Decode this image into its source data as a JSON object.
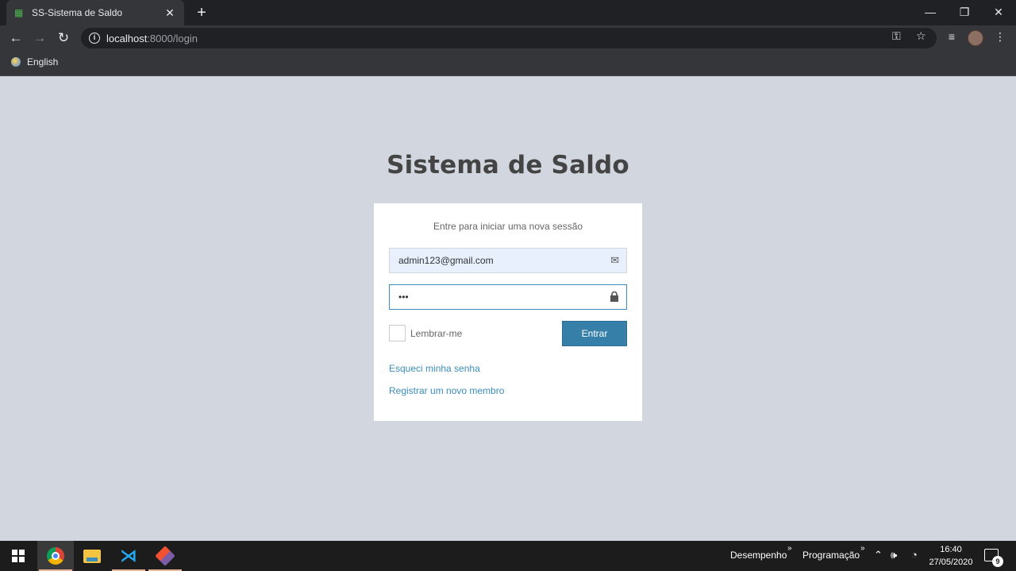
{
  "browser": {
    "tab_title": "SS-Sistema de Saldo",
    "tab_close": "✕",
    "new_tab": "+",
    "window_controls": {
      "minimize": "—",
      "restore": "❐",
      "close": "✕"
    },
    "nav": {
      "back": "←",
      "forward": "→",
      "reload": "↻"
    },
    "url_host": "localhost",
    "url_path": ":8000/login",
    "bookmark_label": "English"
  },
  "page": {
    "logo": "Sistema de Saldo",
    "box_message": "Entre para iniciar uma nova sessão",
    "email_value": "admin123@gmail.com",
    "password_value": "•••",
    "remember_label": "Lembrar-me",
    "submit_label": "Entrar",
    "forgot_link": "Esqueci minha senha",
    "register_link": "Registrar um novo membro"
  },
  "taskbar": {
    "toolbar1": "Desempenho",
    "toolbar2": "Programação",
    "chevron": "»",
    "time": "16:40",
    "date": "27/05/2020",
    "notification_count": "9"
  },
  "colors": {
    "page_bg": "#d2d6de",
    "primary_button": "#367fa9",
    "link": "#3c8dbc"
  }
}
